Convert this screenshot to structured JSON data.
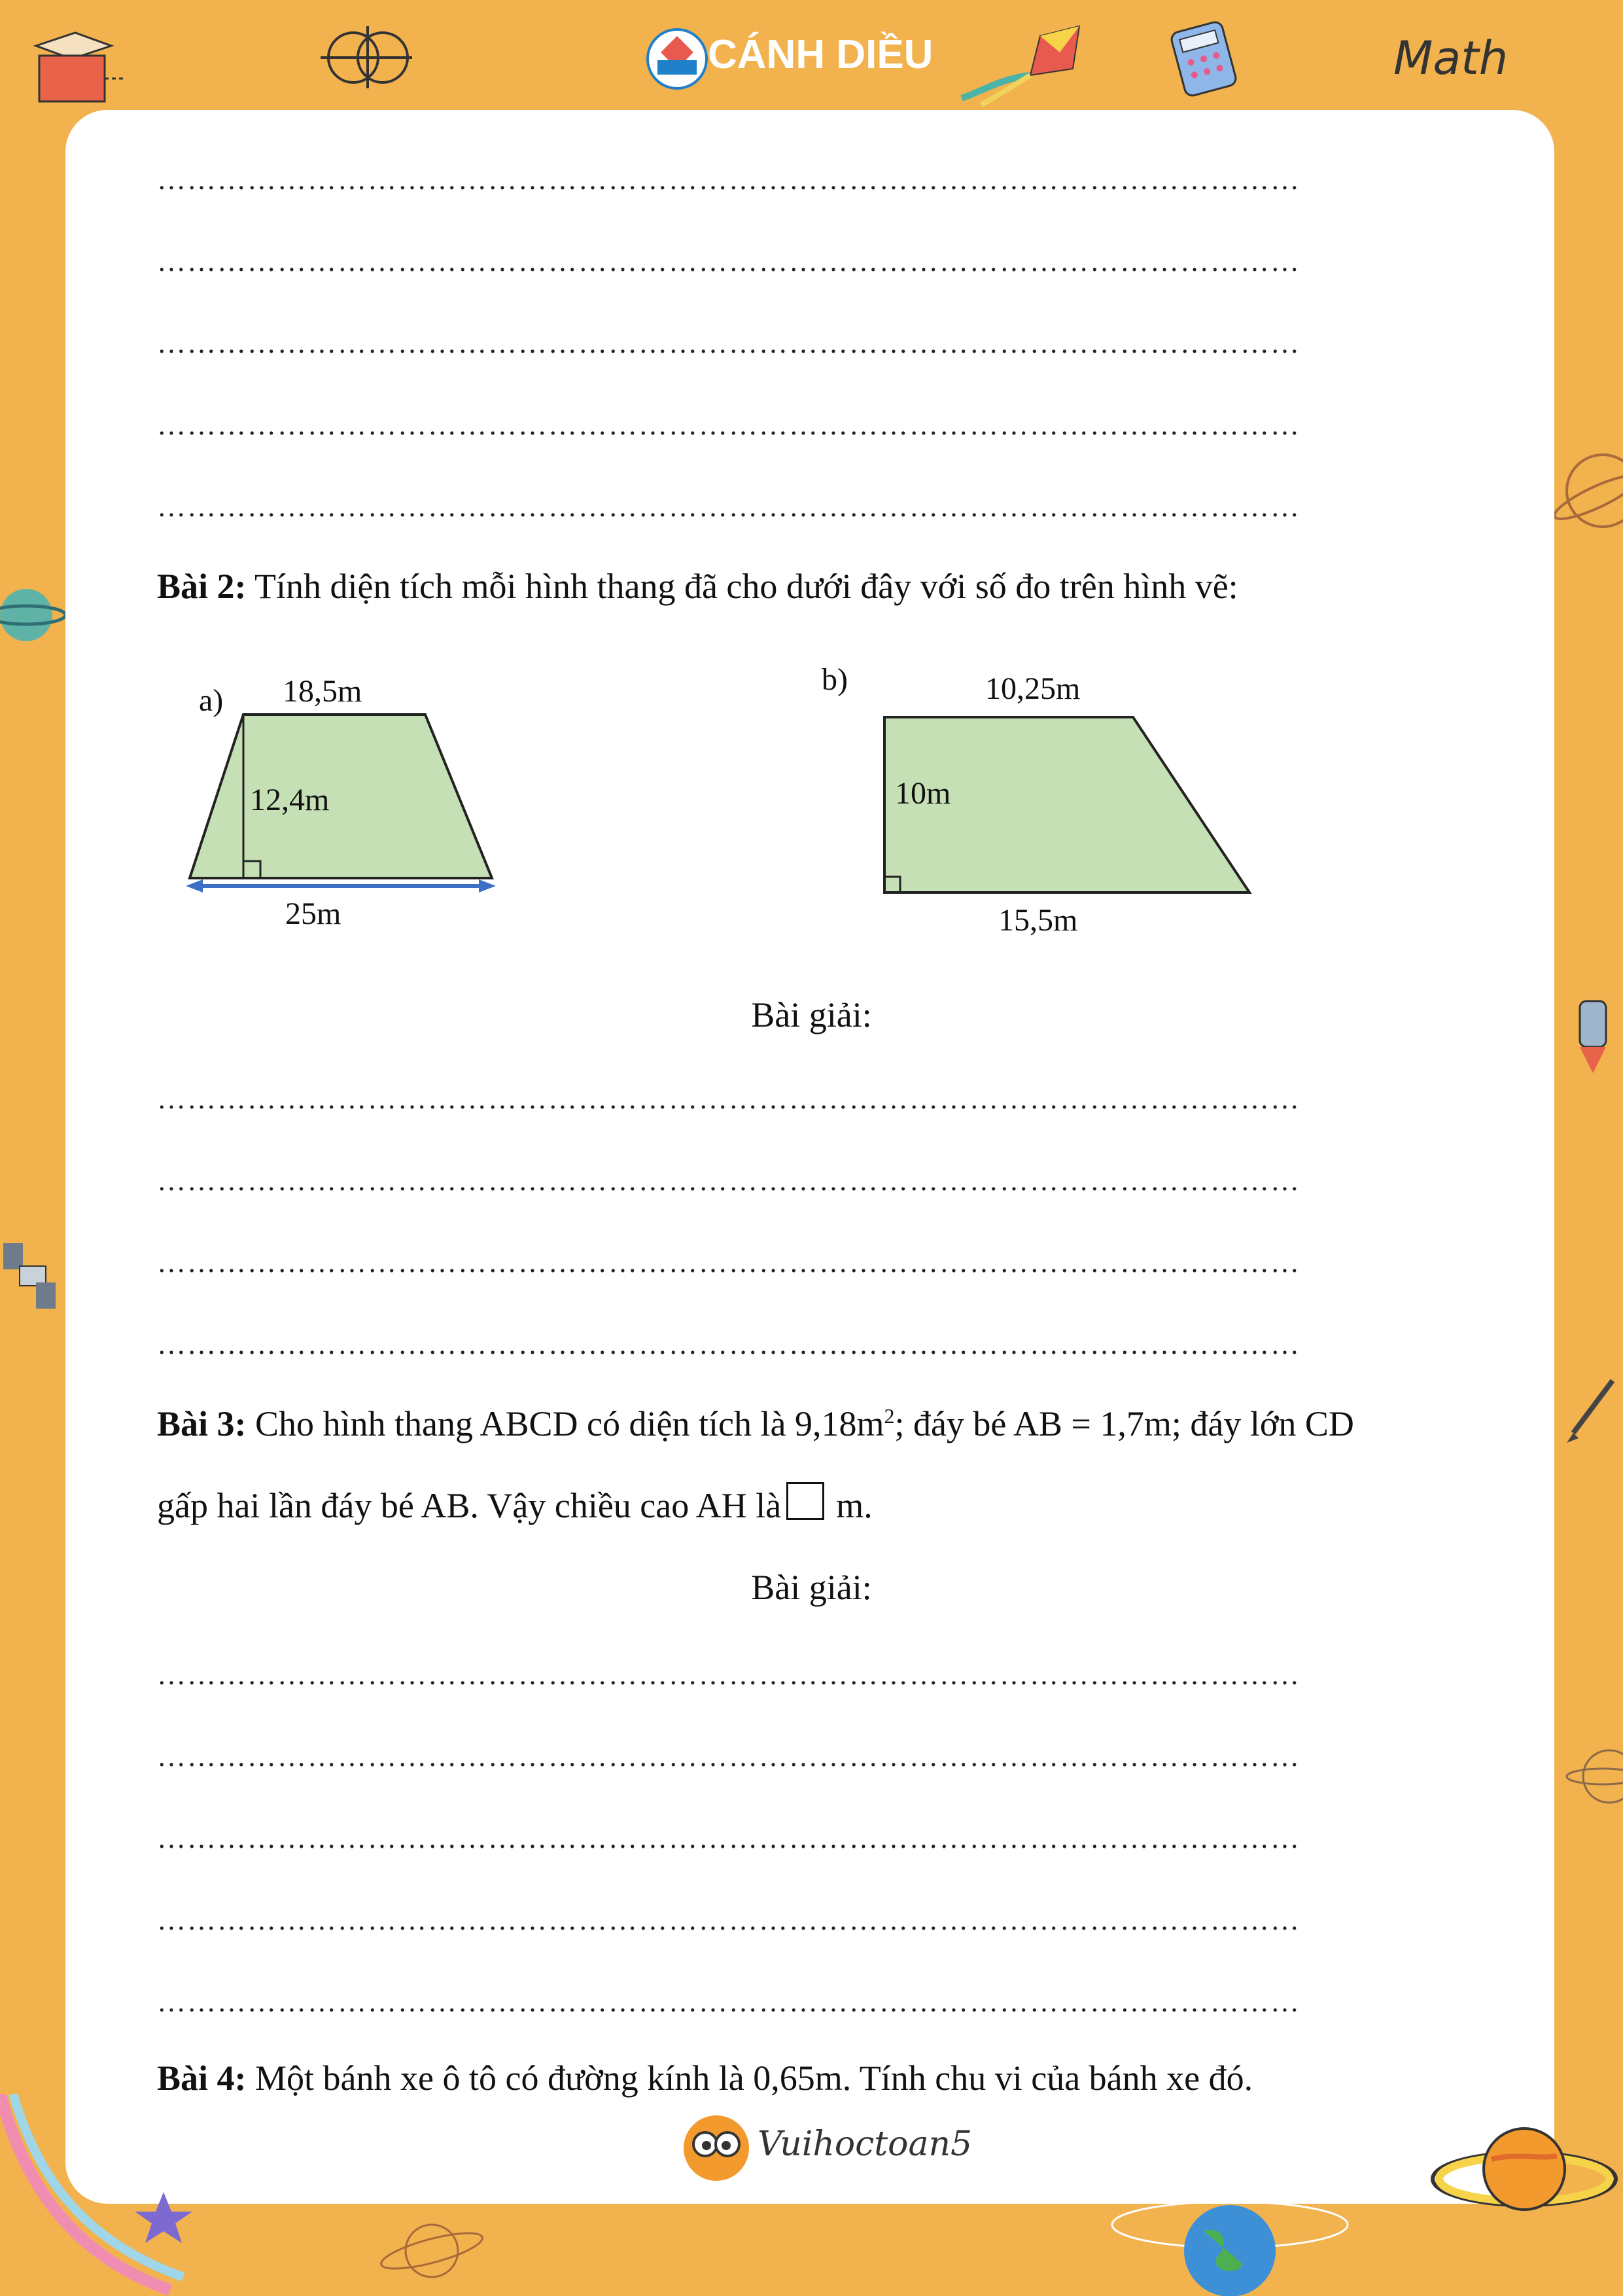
{
  "header": {
    "brand": "CÁNH DIỀU",
    "badge": "Cánh Diều",
    "math_word": "Math"
  },
  "answer_lines_top": [
    "……………………………………………………………………………………………………",
    "……………………………………………………………………………………………………",
    "……………………………………………………………………………………………………",
    "……………………………………………………………………………………………………",
    "……………………………………………………………………………………………………"
  ],
  "bai2": {
    "label": "Bài 2:",
    "text": " Tính diện tích mỗi hình thang đã cho dưới đây với số đo trên hình vẽ:",
    "fig_a": {
      "tag": "a)",
      "top": "18,5m",
      "height": "12,4m",
      "bottom": "25m"
    },
    "fig_b": {
      "tag": "b)",
      "top": "10,25m",
      "height": "10m",
      "bottom": "15,5m"
    },
    "solution_title": "Bài giải:",
    "lines": [
      "……………………………………………………………………………………………………",
      "……………………………………………………………………………………………………",
      "……………………………………………………………………………………………………",
      "……………………………………………………………………………………………………"
    ]
  },
  "bai3": {
    "label": "Bài 3:",
    "text1": " Cho hình thang ABCD có diện tích là 9,18m",
    "sup": "2",
    "text2": "; đáy bé AB = 1,7m; đáy lớn CD",
    "line2a": "gấp hai lần đáy bé AB. Vậy chiều cao AH là",
    "line2b": "m.",
    "solution_title": "Bài giải:",
    "lines": [
      "……………………………………………………………………………………………………",
      "……………………………………………………………………………………………………",
      "……………………………………………………………………………………………………",
      "……………………………………………………………………………………………………",
      "……………………………………………………………………………………………………"
    ]
  },
  "bai4": {
    "label": "Bài 4:",
    "text": " Một bánh xe ô tô có đường kính là 0,65m. Tính chu vi của bánh xe đó."
  },
  "footer": {
    "logo_text": "Vuihoctoan5"
  },
  "colors": {
    "frame": "#f2b24e",
    "shape_fill": "#c5e0b4",
    "brand_blue": "#1f7fc9"
  }
}
